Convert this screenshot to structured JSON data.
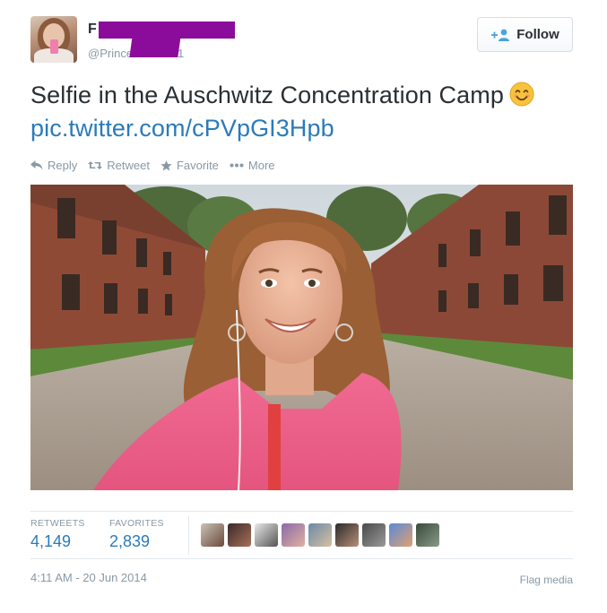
{
  "author": {
    "name_visible_fragment": "F",
    "handle_visible_start": "@Prince",
    "handle_visible_end": "1"
  },
  "follow_button": {
    "label": "Follow",
    "icon": "add-user-icon"
  },
  "tweet": {
    "text": "Selfie in the Auschwitz Concentration Camp",
    "emoji": "smiling-face-emoji",
    "link": "pic.twitter.com/cPVpGI3Hpb"
  },
  "actions": [
    {
      "label": "Reply",
      "icon": "reply-icon"
    },
    {
      "label": "Retweet",
      "icon": "retweet-icon"
    },
    {
      "label": "Favorite",
      "icon": "star-icon"
    },
    {
      "label": "More",
      "icon": "more-dots-icon"
    }
  ],
  "stats": {
    "retweets_label": "RETWEETS",
    "retweets_count": "4,149",
    "favorites_label": "FAVORITES",
    "favorites_count": "2,839"
  },
  "favoriter_avatars": 9,
  "timestamp": "4:11 AM - 20 Jun 2014",
  "flag_label": "Flag media",
  "colors": {
    "link": "#2b7bb9",
    "muted": "#8899a6",
    "text": "#292f33",
    "redaction": "#8b0c9a"
  }
}
